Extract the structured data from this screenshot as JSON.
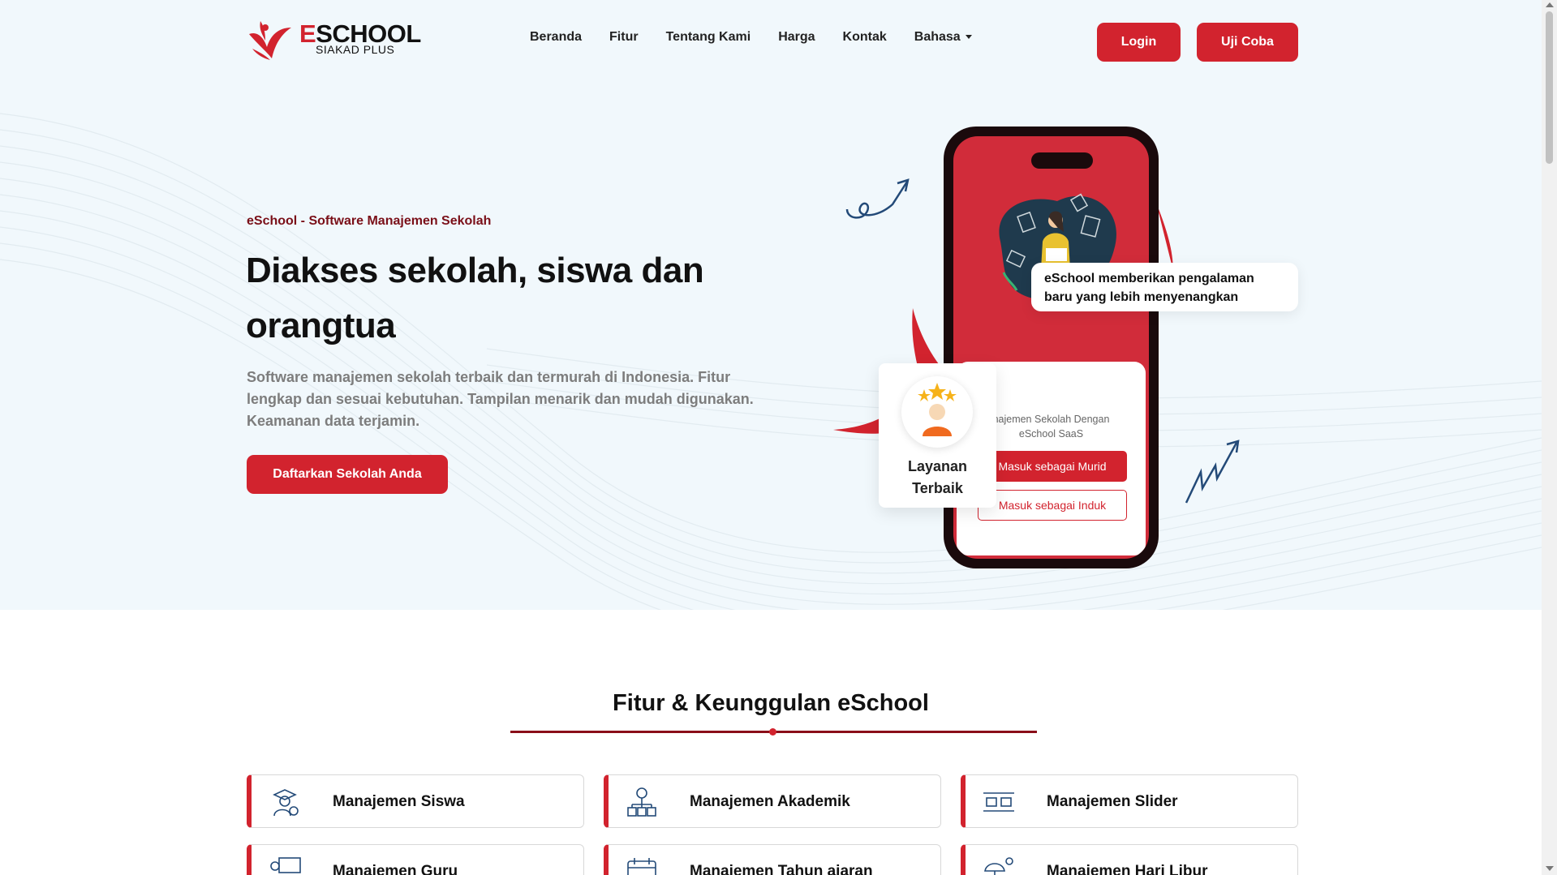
{
  "brand": {
    "logo_first_letter": "E",
    "logo_rest": "SCHOOL",
    "logo_sub": "SIAKAD PLUS",
    "accent_color": "#d2232e",
    "dark_red": "#7a0f18"
  },
  "nav": {
    "items": [
      "Beranda",
      "Fitur",
      "Tentang Kami",
      "Harga",
      "Kontak"
    ],
    "language": "Bahasa",
    "login": "Login",
    "trial": "Uji Coba"
  },
  "hero": {
    "eyebrow": "eSchool - Software Manajemen Sekolah",
    "headline": "Diakses sekolah, siswa dan orangtua",
    "lead": "Software manajemen sekolah terbaik dan termurah di Indonesia. Fitur lengkap dan sesuai kebutuhan. Tampilan menarik dan mudah digunakan. Keamanan data terjamin.",
    "cta": "Daftarkan Sekolah Anda"
  },
  "phone": {
    "caption_line1": "najemen Sekolah Dengan",
    "caption_line2": "eSchool SaaS",
    "btn_student": "Masuk sebagai Murid",
    "btn_parent": "Masuk sebagai Induk"
  },
  "callout": {
    "text": "eSchool memberikan pengalaman baru yang lebih menyenangkan"
  },
  "badge": {
    "line1": "Layanan",
    "line2": "Terbaik"
  },
  "features": {
    "title": "Fitur & Keunggulan eSchool",
    "items": [
      {
        "label": "Manajemen Siswa",
        "icon": "student-gear-icon"
      },
      {
        "label": "Manajemen Akademik",
        "icon": "academic-network-icon"
      },
      {
        "label": "Manajemen Slider",
        "icon": "slider-layout-icon"
      },
      {
        "label": "Manajemen Guru",
        "icon": "teacher-board-icon"
      },
      {
        "label": "Manajemen Tahun ajaran",
        "icon": "calendar-year-icon"
      },
      {
        "label": "Manajemen Hari Libur",
        "icon": "holiday-umbrella-icon"
      }
    ]
  }
}
